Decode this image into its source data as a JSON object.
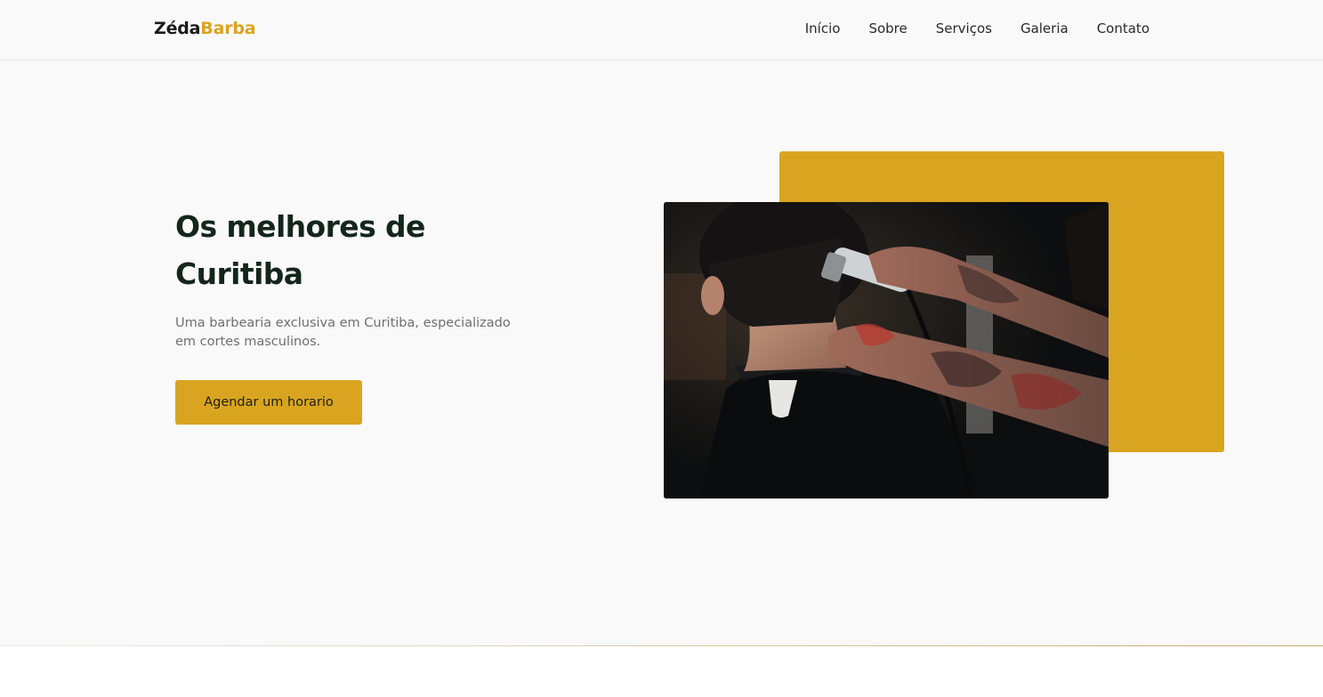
{
  "brand": {
    "logo_part1": "Zéda",
    "logo_part2": "Barba",
    "accent_color": "#d9a521",
    "dark_color": "#14261c"
  },
  "nav": {
    "items": [
      "Início",
      "Sobre",
      "Serviços",
      "Galeria",
      "Contato"
    ]
  },
  "hero": {
    "title_line1": "Os melhores de",
    "title_line2": "Curitiba",
    "subtitle": "Uma barbearia exclusiva em Curitiba, especializado em cortes masculinos.",
    "cta_label": "Agendar um horario",
    "image_alt": "barber-trimming-client-neck-photo"
  }
}
